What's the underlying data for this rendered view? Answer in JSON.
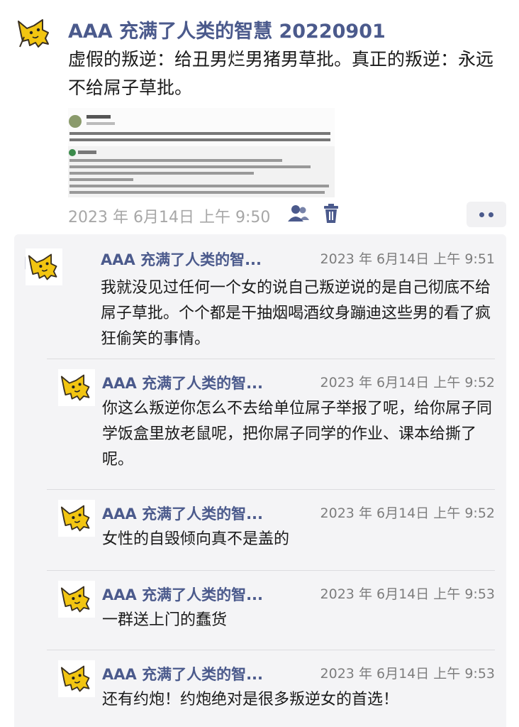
{
  "post": {
    "title": "AAA 充满了人类的智慧 20220901",
    "text": "虚假的叛逆：给丑男烂男猪男草批。真正的叛逆：永远不给屌子草批。",
    "timestamp": "2023 年 6月14日 上午 9:50",
    "icons": {
      "participants": "people-icon",
      "delete": "trash-icon",
      "more": "more-dots-icon"
    }
  },
  "colors": {
    "accent": "#4b5a8c",
    "panel": "#f4f4f6",
    "meta": "#a7a7a7"
  },
  "comments": [
    {
      "author": "AAA 充满了人类的智...",
      "time": "2023 年 6月14日 上午 9:51",
      "text": "我就没见过任何一个女的说自己叛逆说的是自己彻底不给屌子草批。个个都是干抽烟喝酒纹身蹦迪这些男的看了疯狂偷笑的事情。"
    },
    {
      "author": "AAA 充满了人类的智...",
      "time": "2023 年 6月14日 上午 9:52",
      "text": "你这么叛逆你怎么不去给单位屌子举报了呢，给你屌子同学饭盒里放老鼠呢，把你屌子同学的作业、课本给撕了呢。"
    },
    {
      "author": "AAA 充满了人类的智...",
      "time": "2023 年 6月14日 上午 9:52",
      "text": "女性的自毁倾向真不是盖的"
    },
    {
      "author": "AAA 充满了人类的智...",
      "time": "2023 年 6月14日 上午 9:53",
      "text": "一群送上门的蠢货"
    },
    {
      "author": "AAA 充满了人类的智...",
      "time": "2023 年 6月14日 上午 9:53",
      "text": "还有约炮！约炮绝对是很多叛逆女的首选！"
    }
  ]
}
